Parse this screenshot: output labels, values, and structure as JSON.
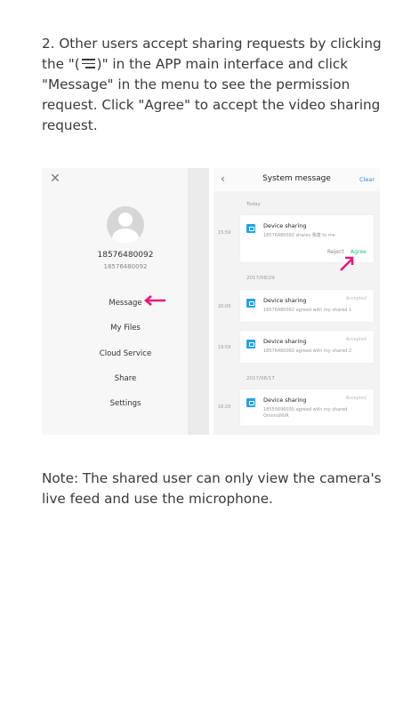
{
  "instructions": {
    "before_icon": "2. Other users accept sharing requests by clicking the \"(",
    "after_icon": ")\" in the APP main interface and click \"Message\" in the menu to see the permission request. Click \"Agree\" to accept the video sharing request."
  },
  "left_panel": {
    "user_name": "18576480092",
    "user_id": "18576480092",
    "menu": [
      "Message",
      "My Files",
      "Cloud Service",
      "Share",
      "Settings"
    ]
  },
  "right_panel": {
    "title": "System message",
    "clear_label": "Clear",
    "groups": [
      {
        "date": "Today",
        "items": [
          {
            "time": "15:59",
            "title": "Device sharing",
            "desc": "18576480092 shares 我捷 to me",
            "status": "",
            "reject": "Reject",
            "agree": "Agree"
          }
        ]
      },
      {
        "date": "2017/08/29",
        "items": [
          {
            "time": "20:00",
            "title": "Device sharing",
            "desc": "18576480092 agreed with my shared 1",
            "status": "Accepted"
          },
          {
            "time": "19:59",
            "title": "Device sharing",
            "desc": "18576480092 agreed with my shared 2",
            "status": "Accepted"
          }
        ]
      },
      {
        "date": "2017/08/17",
        "items": [
          {
            "time": "16:20",
            "title": "Device sharing",
            "desc": "18555696030 agreed with my shared OmimoNVR",
            "status": "Accepted"
          }
        ]
      }
    ]
  },
  "note": "Note: The shared user can only view the camera's live feed and use the microphone.",
  "colors": {
    "arrow": "#e5187e",
    "agree": "#1dbc8a",
    "clear": "#2b8fe0",
    "device_icon": "#25a2e6"
  }
}
